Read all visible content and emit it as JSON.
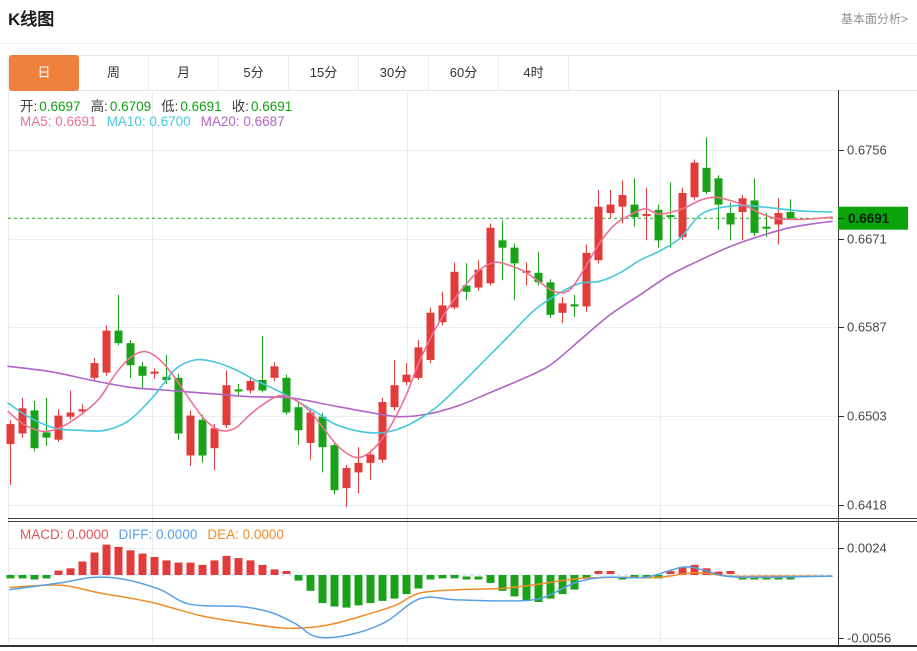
{
  "header": {
    "title": "K线图",
    "link_label": "基本面分析>"
  },
  "tabs": [
    {
      "label": "日",
      "active": true
    },
    {
      "label": "周",
      "active": false
    },
    {
      "label": "月",
      "active": false
    },
    {
      "label": "5分",
      "active": false
    },
    {
      "label": "15分",
      "active": false
    },
    {
      "label": "30分",
      "active": false
    },
    {
      "label": "60分",
      "active": false
    },
    {
      "label": "4时",
      "active": false
    }
  ],
  "ohlc_legend": [
    {
      "label": "开:",
      "value": "0.6697"
    },
    {
      "label": "高:",
      "value": "0.6709"
    },
    {
      "label": "低:",
      "value": "0.6691"
    },
    {
      "label": "收:",
      "value": "0.6691"
    }
  ],
  "ma_legend": [
    {
      "label": "MA5:",
      "value": "0.6691",
      "color": "#ee7191"
    },
    {
      "label": "MA10:",
      "value": "0.6700",
      "color": "#45c8dc"
    },
    {
      "label": "MA20:",
      "value": "0.6687",
      "color": "#b164c8"
    }
  ],
  "macd_legend": [
    {
      "label": "MACD:",
      "value": "0.0000",
      "color": "#e25453"
    },
    {
      "label": "DIFF:",
      "value": "0.0000",
      "color": "#57a0e8"
    },
    {
      "label": "DEA:",
      "value": "0.0000",
      "color": "#f08c28"
    }
  ],
  "colors": {
    "up": "#e23b3b",
    "down": "#1aa21a",
    "ma5": "#ee7191",
    "ma10": "#45c8dc",
    "ma20": "#b164c8",
    "diff": "#57a0e8",
    "dea": "#f08c28",
    "grid": "#e7edf5",
    "axis": "#333333",
    "price_line": "#21a621",
    "zero_line": "#b5d8ee",
    "badge_bg": "#0aa30a",
    "badge_text": "#102010",
    "tick_text": "#474747",
    "legend_label": "#3e3e3e",
    "legend_green": "#12a112",
    "tab_active_bg": "#f0813c",
    "separator": "#3c3c3c"
  },
  "chart_data": {
    "type": "candlestick+macd",
    "price_axis": {
      "ticks": [
        "0.6756",
        "0.6671",
        "0.6587",
        "0.6503",
        "0.6418"
      ],
      "current": "0.6691"
    },
    "macd_axis": {
      "ticks": [
        "0.0024",
        "-0.0056"
      ]
    },
    "candles": [
      [
        0.6476,
        0.6499,
        0.6437,
        0.6495
      ],
      [
        0.6486,
        0.652,
        0.6482,
        0.651
      ],
      [
        0.6508,
        0.6517,
        0.6469,
        0.6472
      ],
      [
        0.6487,
        0.652,
        0.6474,
        0.6482
      ],
      [
        0.648,
        0.6509,
        0.6478,
        0.6503
      ],
      [
        0.6502,
        0.6527,
        0.6499,
        0.6506
      ],
      [
        0.6507,
        0.6514,
        0.6504,
        0.6509
      ],
      [
        0.6539,
        0.6558,
        0.6536,
        0.6553
      ],
      [
        0.6544,
        0.6589,
        0.6541,
        0.6584
      ],
      [
        0.6584,
        0.6618,
        0.657,
        0.6572
      ],
      [
        0.6572,
        0.6575,
        0.6539,
        0.6551
      ],
      [
        0.655,
        0.6554,
        0.6529,
        0.6541
      ],
      [
        0.6543,
        0.6548,
        0.6538,
        0.6545
      ],
      [
        0.654,
        0.6561,
        0.6533,
        0.6537
      ],
      [
        0.6539,
        0.6543,
        0.648,
        0.6486
      ],
      [
        0.6465,
        0.6508,
        0.6455,
        0.6503
      ],
      [
        0.6499,
        0.6504,
        0.6458,
        0.6465
      ],
      [
        0.6472,
        0.6495,
        0.6451,
        0.6491
      ],
      [
        0.6494,
        0.6546,
        0.6491,
        0.6532
      ],
      [
        0.6528,
        0.6533,
        0.6522,
        0.6526
      ],
      [
        0.6527,
        0.654,
        0.6524,
        0.6536
      ],
      [
        0.6537,
        0.6579,
        0.6525,
        0.6527
      ],
      [
        0.6539,
        0.6554,
        0.6536,
        0.655
      ],
      [
        0.6539,
        0.6542,
        0.6504,
        0.6506
      ],
      [
        0.6511,
        0.6515,
        0.6475,
        0.6489
      ],
      [
        0.6477,
        0.651,
        0.6461,
        0.6506
      ],
      [
        0.6502,
        0.6506,
        0.6449,
        0.6473
      ],
      [
        0.6475,
        0.6478,
        0.6428,
        0.6432
      ],
      [
        0.6434,
        0.6456,
        0.6416,
        0.6453
      ],
      [
        0.6449,
        0.6473,
        0.6429,
        0.6458
      ],
      [
        0.6458,
        0.647,
        0.6442,
        0.6466
      ],
      [
        0.6461,
        0.652,
        0.6458,
        0.6516
      ],
      [
        0.6511,
        0.6556,
        0.6508,
        0.6532
      ],
      [
        0.6535,
        0.6553,
        0.6532,
        0.6542
      ],
      [
        0.6539,
        0.6575,
        0.6537,
        0.6568
      ],
      [
        0.6556,
        0.6606,
        0.6553,
        0.6601
      ],
      [
        0.6592,
        0.6621,
        0.6589,
        0.6608
      ],
      [
        0.6606,
        0.6649,
        0.6604,
        0.664
      ],
      [
        0.6627,
        0.6648,
        0.6613,
        0.6621
      ],
      [
        0.6625,
        0.6651,
        0.6622,
        0.6642
      ],
      [
        0.6629,
        0.6686,
        0.6627,
        0.6682
      ],
      [
        0.667,
        0.6689,
        0.6632,
        0.6663
      ],
      [
        0.6663,
        0.6667,
        0.6613,
        0.6648
      ],
      [
        0.6639,
        0.6649,
        0.6627,
        0.6641
      ],
      [
        0.6639,
        0.6659,
        0.6627,
        0.663
      ],
      [
        0.663,
        0.6633,
        0.6596,
        0.6599
      ],
      [
        0.6601,
        0.6616,
        0.6591,
        0.661
      ],
      [
        0.6609,
        0.6618,
        0.6597,
        0.6607
      ],
      [
        0.6607,
        0.6666,
        0.6602,
        0.6658
      ],
      [
        0.6651,
        0.6718,
        0.6648,
        0.6702
      ],
      [
        0.6696,
        0.6718,
        0.6691,
        0.6704
      ],
      [
        0.6702,
        0.6727,
        0.6686,
        0.6713
      ],
      [
        0.6704,
        0.6729,
        0.6683,
        0.6692
      ],
      [
        0.6693,
        0.672,
        0.667,
        0.6695
      ],
      [
        0.6699,
        0.6704,
        0.6663,
        0.667
      ],
      [
        0.6694,
        0.6725,
        0.6663,
        0.6692
      ],
      [
        0.6673,
        0.672,
        0.667,
        0.6715
      ],
      [
        0.6711,
        0.6747,
        0.6708,
        0.6744
      ],
      [
        0.6739,
        0.6768,
        0.6714,
        0.6716
      ],
      [
        0.6729,
        0.6732,
        0.668,
        0.6704
      ],
      [
        0.6696,
        0.6706,
        0.667,
        0.6685
      ],
      [
        0.6697,
        0.6713,
        0.667,
        0.671
      ],
      [
        0.6708,
        0.6729,
        0.6674,
        0.6677
      ],
      [
        0.6683,
        0.6696,
        0.6673,
        0.6681
      ],
      [
        0.6685,
        0.671,
        0.6666,
        0.6696
      ],
      [
        0.6697,
        0.6709,
        0.6691,
        0.6691
      ]
    ],
    "ma5": [
      [
        8,
        0.6507
      ],
      [
        25,
        0.6494
      ],
      [
        45,
        0.6488
      ],
      [
        65,
        0.6494
      ],
      [
        85,
        0.6507
      ],
      [
        100,
        0.652
      ],
      [
        115,
        0.6542
      ],
      [
        130,
        0.6558
      ],
      [
        145,
        0.6564
      ],
      [
        160,
        0.6556
      ],
      [
        175,
        0.6539
      ],
      [
        190,
        0.6518
      ],
      [
        205,
        0.6499
      ],
      [
        220,
        0.6489
      ],
      [
        235,
        0.6491
      ],
      [
        250,
        0.6504
      ],
      [
        265,
        0.6515
      ],
      [
        280,
        0.6522
      ],
      [
        295,
        0.6518
      ],
      [
        310,
        0.6507
      ],
      [
        325,
        0.6489
      ],
      [
        340,
        0.6472
      ],
      [
        357,
        0.6463
      ],
      [
        372,
        0.647
      ],
      [
        388,
        0.6489
      ],
      [
        405,
        0.652
      ],
      [
        420,
        0.6556
      ],
      [
        435,
        0.6585
      ],
      [
        450,
        0.6608
      ],
      [
        465,
        0.6627
      ],
      [
        480,
        0.6642
      ],
      [
        495,
        0.6649
      ],
      [
        510,
        0.6646
      ],
      [
        525,
        0.664
      ],
      [
        540,
        0.663
      ],
      [
        555,
        0.6621
      ],
      [
        570,
        0.6623
      ],
      [
        585,
        0.6644
      ],
      [
        600,
        0.6668
      ],
      [
        615,
        0.6685
      ],
      [
        630,
        0.6694
      ],
      [
        645,
        0.67
      ],
      [
        658,
        0.6695
      ],
      [
        672,
        0.6697
      ],
      [
        685,
        0.6701
      ],
      [
        700,
        0.6708
      ],
      [
        715,
        0.6711
      ],
      [
        730,
        0.6708
      ],
      [
        745,
        0.6703
      ],
      [
        760,
        0.6696
      ],
      [
        775,
        0.6691
      ],
      [
        790,
        0.669
      ],
      [
        805,
        0.669
      ],
      [
        820,
        0.6691
      ],
      [
        832,
        0.6692
      ]
    ],
    "ma10": [
      [
        8,
        0.6515
      ],
      [
        30,
        0.6501
      ],
      [
        55,
        0.6491
      ],
      [
        80,
        0.6489
      ],
      [
        105,
        0.6489
      ],
      [
        130,
        0.6499
      ],
      [
        155,
        0.6523
      ],
      [
        175,
        0.6547
      ],
      [
        195,
        0.6556
      ],
      [
        215,
        0.6554
      ],
      [
        235,
        0.6547
      ],
      [
        255,
        0.6537
      ],
      [
        275,
        0.6528
      ],
      [
        295,
        0.6518
      ],
      [
        315,
        0.6507
      ],
      [
        335,
        0.6495
      ],
      [
        360,
        0.6488
      ],
      [
        385,
        0.6487
      ],
      [
        410,
        0.6495
      ],
      [
        435,
        0.651
      ],
      [
        460,
        0.6532
      ],
      [
        485,
        0.6556
      ],
      [
        510,
        0.658
      ],
      [
        535,
        0.6604
      ],
      [
        560,
        0.662
      ],
      [
        580,
        0.6629
      ],
      [
        600,
        0.6631
      ],
      [
        620,
        0.6639
      ],
      [
        640,
        0.6651
      ],
      [
        660,
        0.666
      ],
      [
        680,
        0.6672
      ],
      [
        700,
        0.6694
      ],
      [
        720,
        0.6701
      ],
      [
        745,
        0.6703
      ],
      [
        770,
        0.6701
      ],
      [
        800,
        0.6698
      ],
      [
        832,
        0.6697
      ]
    ],
    "ma20": [
      [
        8,
        0.655
      ],
      [
        50,
        0.6545
      ],
      [
        90,
        0.6537
      ],
      [
        130,
        0.653
      ],
      [
        170,
        0.6527
      ],
      [
        210,
        0.6524
      ],
      [
        250,
        0.6521
      ],
      [
        290,
        0.652
      ],
      [
        330,
        0.6513
      ],
      [
        370,
        0.6506
      ],
      [
        400,
        0.6502
      ],
      [
        430,
        0.6505
      ],
      [
        460,
        0.6513
      ],
      [
        490,
        0.6525
      ],
      [
        520,
        0.6537
      ],
      [
        550,
        0.6551
      ],
      [
        580,
        0.6575
      ],
      [
        610,
        0.6599
      ],
      [
        640,
        0.6618
      ],
      [
        670,
        0.6637
      ],
      [
        700,
        0.6651
      ],
      [
        730,
        0.6664
      ],
      [
        760,
        0.6674
      ],
      [
        790,
        0.6682
      ],
      [
        815,
        0.6686
      ],
      [
        832,
        0.6688
      ]
    ],
    "macd_hist": [
      -0.0003,
      -0.0003,
      -0.0004,
      -0.0003,
      0.0004,
      0.0006,
      0.0012,
      0.002,
      0.0027,
      0.0025,
      0.0022,
      0.0019,
      0.0016,
      0.0013,
      0.0011,
      0.0011,
      0.0009,
      0.0013,
      0.0017,
      0.0015,
      0.0013,
      0.0009,
      0.0005,
      0.0002,
      -0.0005,
      -0.0014,
      -0.0025,
      -0.0028,
      -0.0029,
      -0.0027,
      -0.0025,
      -0.0023,
      -0.0021,
      -0.0017,
      -0.0012,
      -0.0004,
      -0.0003,
      -0.0003,
      -0.0002,
      -0.0001,
      -0.0007,
      -0.0014,
      -0.0019,
      -0.0023,
      -0.0024,
      -0.0021,
      -0.0017,
      -0.0013,
      -0.0003,
      0.0001,
      0.0001,
      -0.0002,
      -0.0003,
      -0.0003,
      -0.0003,
      0.0002,
      0.0007,
      0.0009,
      0.0006,
      0.0003,
      0.0001,
      -0.0001,
      -0.0002,
      -0.0001,
      -0.0001,
      -0.0001
    ],
    "diff_line": [
      [
        10,
        -0.0013
      ],
      [
        60,
        -0.0007
      ],
      [
        95,
        -0.0002
      ],
      [
        125,
        -0.0004
      ],
      [
        160,
        -0.0013
      ],
      [
        190,
        -0.0026
      ],
      [
        240,
        -0.0028
      ],
      [
        270,
        -0.0033
      ],
      [
        295,
        -0.0043
      ],
      [
        317,
        -0.0055
      ],
      [
        350,
        -0.0053
      ],
      [
        385,
        -0.0042
      ],
      [
        420,
        -0.0021
      ],
      [
        455,
        -0.0022
      ],
      [
        500,
        -0.0023
      ],
      [
        540,
        -0.0021
      ],
      [
        575,
        -0.0007
      ],
      [
        605,
        -0.0002
      ],
      [
        645,
        -0.0002
      ],
      [
        683,
        0.0007
      ],
      [
        705,
        0.0004
      ],
      [
        725,
        -0.0001
      ],
      [
        760,
        -0.0002
      ],
      [
        832,
        -0.0001
      ]
    ],
    "dea_line": [
      [
        10,
        -0.0011
      ],
      [
        60,
        -0.0009
      ],
      [
        100,
        -0.0016
      ],
      [
        150,
        -0.0024
      ],
      [
        200,
        -0.0036
      ],
      [
        240,
        -0.0042
      ],
      [
        280,
        -0.0047
      ],
      [
        305,
        -0.0047
      ],
      [
        330,
        -0.0044
      ],
      [
        360,
        -0.0037
      ],
      [
        395,
        -0.0027
      ],
      [
        420,
        -0.0016
      ],
      [
        460,
        -0.0013
      ],
      [
        500,
        -0.0012
      ],
      [
        540,
        -0.0008
      ],
      [
        580,
        -0.0003
      ],
      [
        620,
        -0.0002
      ],
      [
        660,
        -0.0002
      ],
      [
        695,
        0.0002
      ],
      [
        730,
        -0.0001
      ],
      [
        770,
        -0.0001
      ],
      [
        832,
        -0.0001
      ]
    ]
  }
}
